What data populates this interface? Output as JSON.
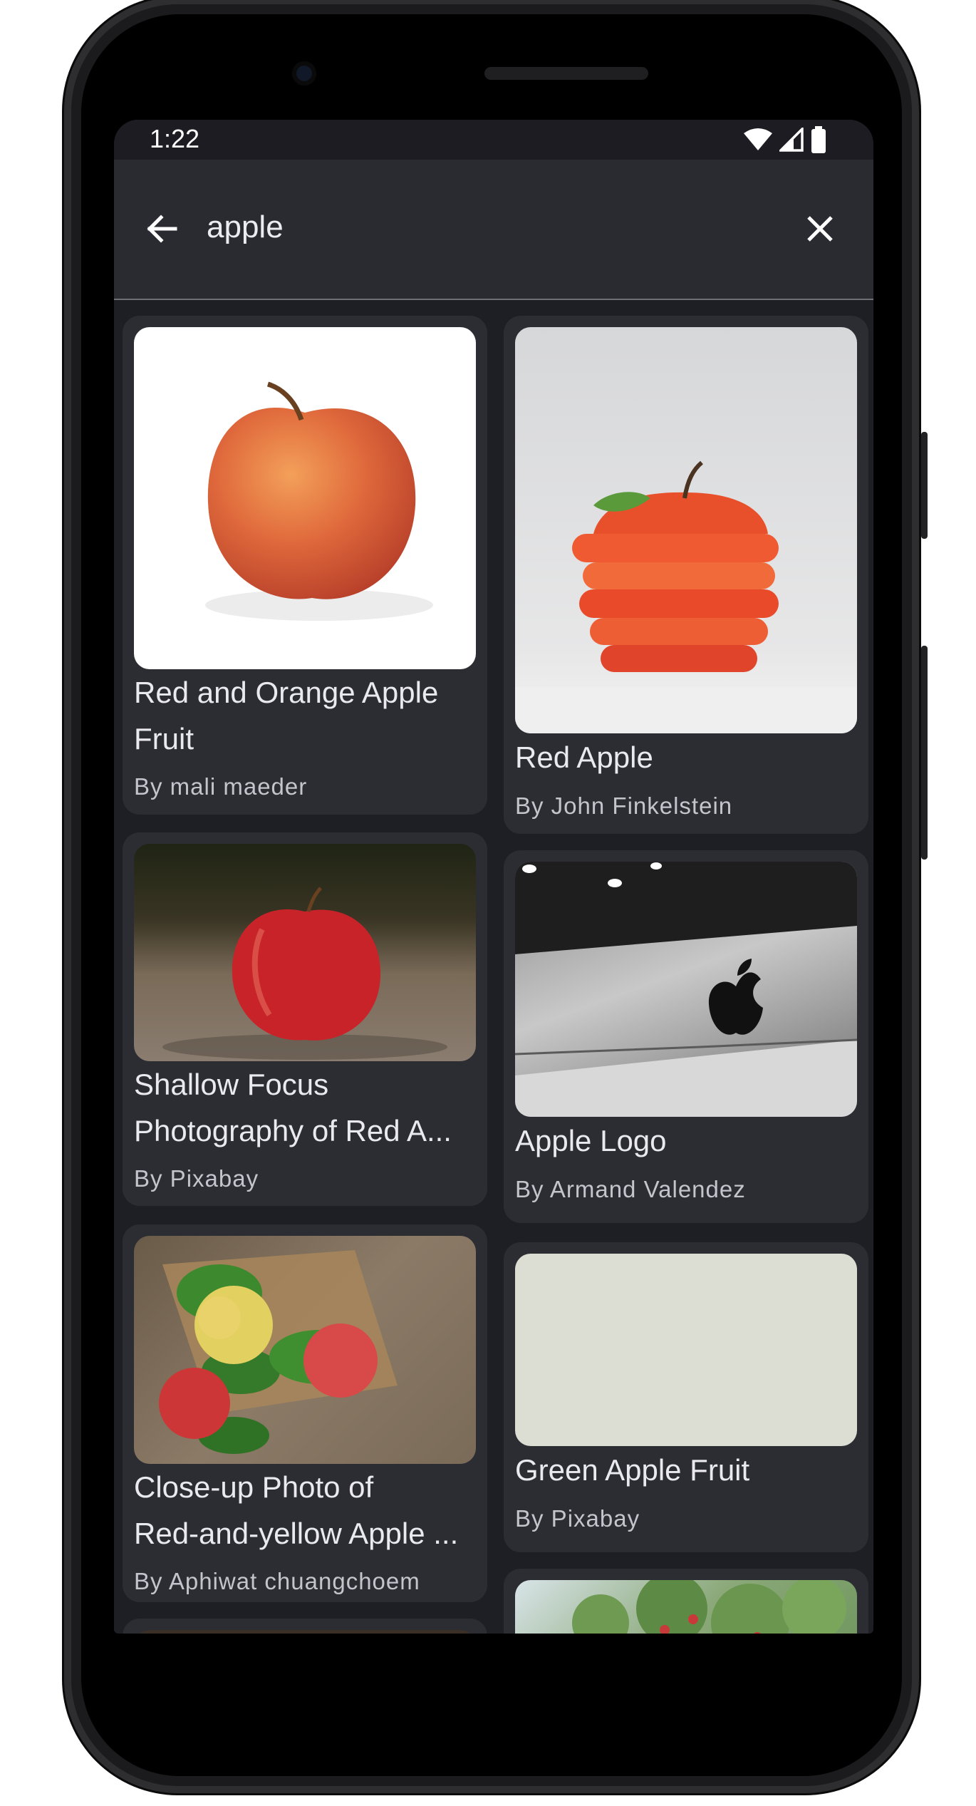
{
  "status": {
    "time": "1:22"
  },
  "search": {
    "query": "apple",
    "back_label": "Back",
    "clear_label": "Clear search"
  },
  "icons": {
    "back": "arrow-left-icon",
    "clear": "close-icon",
    "wifi": "wifi-icon",
    "signal": "signal-icon",
    "battery": "battery-icon"
  },
  "colors": {
    "background": "#1e1e25",
    "card": "#2c2c33",
    "app_bar": "#2a2a31",
    "text": "#eaeaee",
    "subtext": "#c4c4cc"
  },
  "results": [
    {
      "title_line1": "Red and Orange Apple",
      "title_line2": "Fruit",
      "author": "By mali maeder"
    },
    {
      "title_line1": "Red Apple",
      "author": "By John  Finkelstein"
    },
    {
      "title_line1": "Shallow Focus",
      "title_line2": "Photography of Red A...",
      "author": "By Pixabay"
    },
    {
      "title_line1": "Apple Logo",
      "author": "By Armand Valendez"
    },
    {
      "title_line1": "Close-up Photo of",
      "title_line2": "Red-and-yellow Apple ...",
      "author": "By Aphiwat  chuangchoem"
    },
    {
      "title_line1": "Green Apple Fruit",
      "author": "By Pixabay"
    }
  ]
}
